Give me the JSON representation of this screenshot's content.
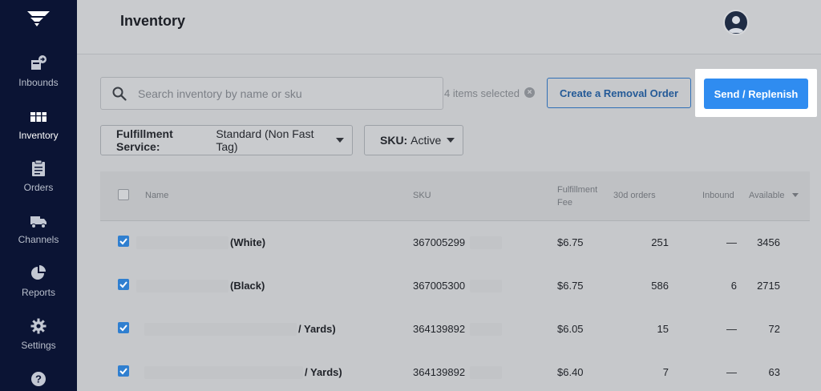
{
  "sidebar": {
    "items": [
      {
        "label": "Inbounds",
        "icon": "inbound-box-icon",
        "active": false
      },
      {
        "label": "Inventory",
        "icon": "inventory-icon",
        "active": true
      },
      {
        "label": "Orders",
        "icon": "clipboard-icon",
        "active": false
      },
      {
        "label": "Channels",
        "icon": "truck-icon",
        "active": false
      },
      {
        "label": "Reports",
        "icon": "pie-chart-icon",
        "active": false
      },
      {
        "label": "Settings",
        "icon": "gear-icon",
        "active": false
      },
      {
        "label": "",
        "icon": "help-icon",
        "active": false
      }
    ]
  },
  "header": {
    "title": "Inventory"
  },
  "toolbar": {
    "search_placeholder": "Search inventory by name or sku",
    "search_value": "",
    "selected_text": "4 items selected",
    "removal_label": "Create a Removal Order",
    "send_label": "Send / Replenish"
  },
  "filters": {
    "fulfillment": {
      "key": "Fulfillment Service:",
      "value": "Standard (Non Fast Tag)"
    },
    "sku": {
      "key": "SKU:",
      "value": "Active"
    }
  },
  "table": {
    "columns": {
      "name": "Name",
      "sku": "SKU",
      "fee_line1": "Fulfillment",
      "fee_line2": "Fee",
      "orders": "30d orders",
      "inbound": "Inbound",
      "available": "Available"
    },
    "rows": [
      {
        "name": "(White)",
        "sku": "367005299",
        "fee": "$6.75",
        "orders": "251",
        "inbound": "—",
        "available": "3456"
      },
      {
        "name": "(Black)",
        "sku": "367005300",
        "fee": "$6.75",
        "orders": "586",
        "inbound": "6",
        "available": "2715"
      },
      {
        "name": "/ Yards)",
        "sku": "364139892",
        "fee": "$6.05",
        "orders": "15",
        "inbound": "—",
        "available": "72"
      },
      {
        "name": "/ Yards)",
        "sku": "364139892",
        "fee": "$6.40",
        "orders": "7",
        "inbound": "—",
        "available": "63"
      }
    ]
  },
  "colors": {
    "sidebar_bg": "#0b1434",
    "primary": "#2f8cf0",
    "outline": "#2f6fb6",
    "checkbox": "#2f7fd0"
  }
}
